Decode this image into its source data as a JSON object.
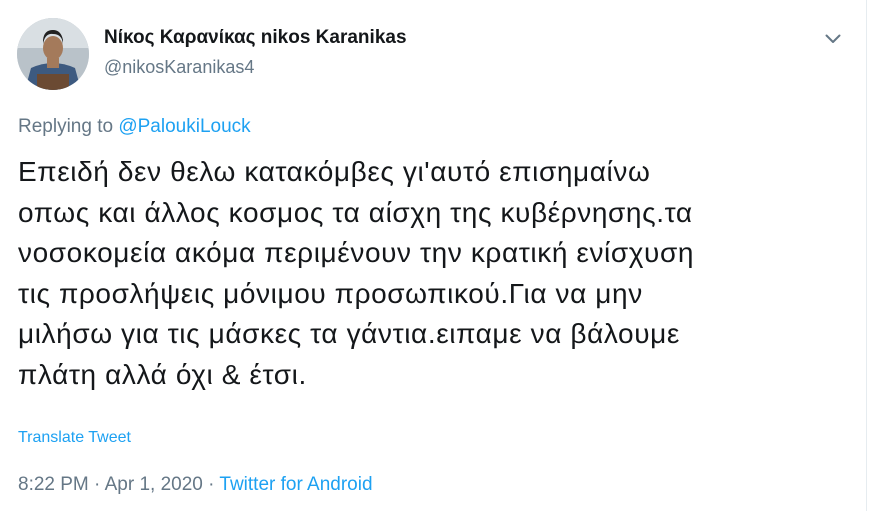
{
  "author": {
    "display_name": "Νίκος Καρανίκας nikos Karanikas",
    "handle": "@nikosKaranikas4"
  },
  "reply": {
    "prefix": "Replying to ",
    "mention": "@PaloukiLouck"
  },
  "tweet": {
    "lines": [
      "Επειδή δεν θελω κατακόμβες γι'αυτό επισημαίνω",
      "οπως και άλλος κοσμος τα αίσχη της κυβέρνησης.τα",
      "νοσοκομεία ακόμα περιμένουν την κρατική ενίσχυση",
      "τις προσλήψεις μόνιμου προσωπικού.Για να μην",
      "μιλήσω για τις μάσκες τα γάντια.ειπαμε να βάλουμε",
      "πλάτη αλλά όχι & έτσι."
    ]
  },
  "translate_label": "Translate Tweet",
  "meta": {
    "time": "8:22 PM",
    "sep1": " · ",
    "date": "Apr 1, 2020",
    "sep2": " · ",
    "source": "Twitter for Android"
  },
  "icons": {
    "caret": "chevron-down-icon"
  },
  "colors": {
    "link": "#1da1f2",
    "secondary": "#657786",
    "text": "#14171a"
  }
}
